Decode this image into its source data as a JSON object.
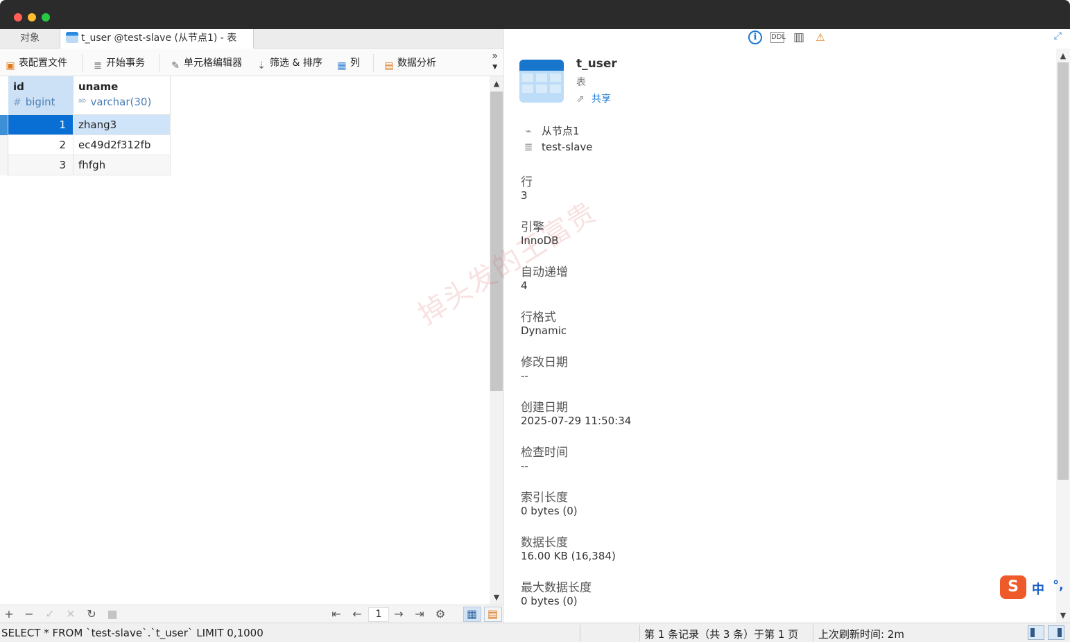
{
  "tabs": {
    "objects_label": "对象",
    "active_label": "t_user @test-slave (从节点1) - 表"
  },
  "toolbar": {
    "table_config": "表配置文件",
    "begin_transaction": "开始事务",
    "cell_editor": "单元格编辑器",
    "filter_sort": "筛选 & 排序",
    "columns": "列",
    "data_analysis": "数据分析",
    "more_glyph": "»"
  },
  "grid": {
    "columns": [
      {
        "name": "id",
        "type": "bigint",
        "type_icon": "#"
      },
      {
        "name": "uname",
        "type": "varchar(30)",
        "type_icon": "abc-icon"
      }
    ],
    "rows": [
      {
        "id": "1",
        "uname": "zhang3"
      },
      {
        "id": "2",
        "uname": "ec49d2f312fb"
      },
      {
        "id": "3",
        "uname": "fhfgh"
      }
    ],
    "selected_row": 0
  },
  "pager": {
    "current_page": "1"
  },
  "object_info": {
    "name": "t_user",
    "type": "表",
    "share_label": "共享",
    "connection": "从节点1",
    "database": "test-slave",
    "properties": [
      {
        "label": "行",
        "value": "3"
      },
      {
        "label": "引擎",
        "value": "InnoDB"
      },
      {
        "label": "自动递增",
        "value": "4"
      },
      {
        "label": "行格式",
        "value": "Dynamic"
      },
      {
        "label": "修改日期",
        "value": "--"
      },
      {
        "label": "创建日期",
        "value": "2025-07-29 11:50:34"
      },
      {
        "label": "检查时间",
        "value": "--"
      },
      {
        "label": "索引长度",
        "value": "0 bytes (0)"
      },
      {
        "label": "数据长度",
        "value": "16.00 KB (16,384)"
      },
      {
        "label": "最大数据长度",
        "value": "0 bytes (0)"
      }
    ]
  },
  "watermark": "掉头发的王富贵",
  "ime": {
    "logo": "S",
    "mode": "中",
    "punct": "°,"
  },
  "status": {
    "query": "SELECT * FROM `test-slave`.`t_user` LIMIT 0,1000",
    "record_info": "第 1 条记录（共 3 条）于第 1 页",
    "last_refresh": "上次刷新时间: 2m"
  }
}
